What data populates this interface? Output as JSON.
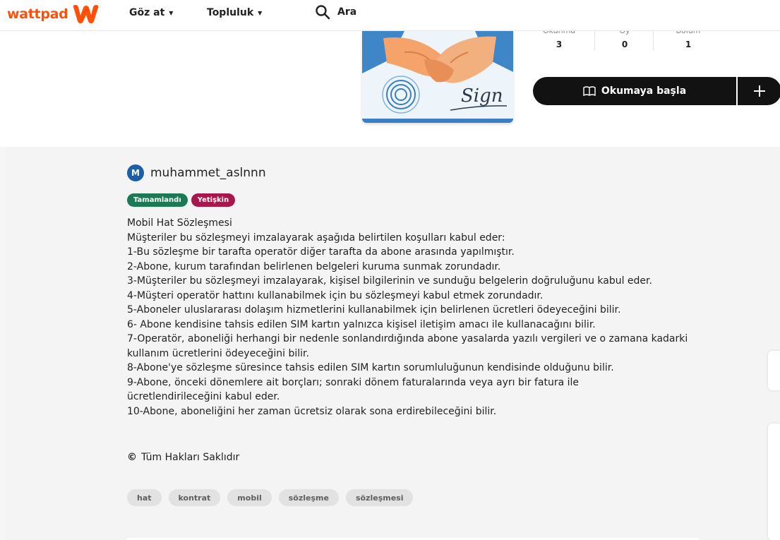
{
  "nav": {
    "logo_text": "wattpad",
    "brand_color": "#ff500a",
    "browse_label": "Göz at",
    "community_label": "Topluluk",
    "search_label": "Ara"
  },
  "story": {
    "stats": [
      {
        "label": "Okunma",
        "value": "3"
      },
      {
        "label": "Oy",
        "value": "0"
      },
      {
        "label": "Bölüm",
        "value": "1"
      }
    ],
    "read_button_label": "Okumaya başla",
    "cover_sign_text": "Sign",
    "author": {
      "initial": "M",
      "name": "muhammet_aslnnn"
    },
    "badges": {
      "status": "Tamamlandı",
      "rating": "Yetişkin"
    },
    "description_lines": [
      "Mobil Hat Sözleşmesi",
      "Müşteriler bu sözleşmeyi imzalayarak aşağıda belirtilen koşulları kabul eder:",
      "1-Bu sözleşme bir tarafta operatör diğer tarafta da abone arasında yapılmıştır.",
      "2-Abone,  kurum tarafından belirlenen belgeleri kuruma sunmak zorundadır.",
      "3-Müşteriler bu sözleşmeyi imzalayarak, kişisel bilgilerinin ve sunduğu belgelerin doğruluğunu kabul eder.",
      "4-Müşteri operatör hattını kullanabilmek için bu sözleşmeyi kabul etmek zorundadır.",
      "5-Aboneler uluslararası dolaşım hizmetlerini kullanabilmek için belirlenen ücretleri ödeyeceğini bilir.",
      "6- Abone kendisine  tahsis edilen SIM kartın yalnızca kişisel iletişim amacı ile kullanacağını bilir.",
      "7-Operatör, aboneliği herhangi bir nedenle sonlandırdığında abone yasalarda yazılı vergileri ve o zamana kadarki kullanım ücretlerini ödeyeceğini bilir.",
      "8-Abone'ye sözleşme süresince tahsis edilen SIM kartın sorumluluğunun kendisinde olduğunu bilir.",
      "9-Abone, önceki dönemlere ait borçları; sonraki dönem faturalarında veya ayrı bir fatura ile ücretlendirileceğini kabul eder.",
      "10-Abone, aboneliğini her zaman ücretsiz olarak sona erdirebileceğini bilir."
    ],
    "copyright_symbol": "©",
    "copyright_text": "Tüm Hakları Saklıdır",
    "tags": [
      "hat",
      "kontrat",
      "mobil",
      "sözleşme",
      "sözleşmesi"
    ]
  }
}
